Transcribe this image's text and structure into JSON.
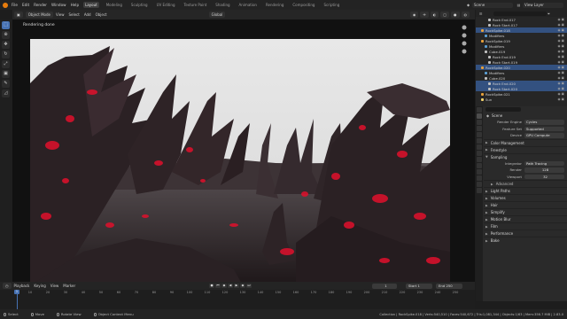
{
  "menu": {
    "items": [
      "File",
      "Edit",
      "Render",
      "Window",
      "Help"
    ],
    "workspaces": [
      "Layout",
      "Modeling",
      "Sculpting",
      "UV Editing",
      "Texture Paint",
      "Shading",
      "Animation",
      "Rendering",
      "Compositing",
      "Scripting"
    ],
    "active_workspace": "Layout",
    "scene_name": "Scene",
    "view_layer": "View Layer"
  },
  "viewport_header": {
    "mode": "Object Mode",
    "menus": [
      "View",
      "Select",
      "Add",
      "Object"
    ],
    "orientation": "Global"
  },
  "viewport": {
    "status": "Rendering done"
  },
  "outliner": {
    "rows": [
      {
        "label": "Rock End.017",
        "selected": false
      },
      {
        "label": "Rock Start.017",
        "selected": false
      },
      {
        "label": "RockSpike.018",
        "selected": true
      },
      {
        "label": "Modifiers",
        "selected": false
      },
      {
        "label": "RockSpike.019",
        "selected": false
      },
      {
        "label": "Modifiers",
        "selected": false
      },
      {
        "label": "Cube.019",
        "selected": false
      },
      {
        "label": "Rock End.019",
        "selected": false
      },
      {
        "label": "Rock Start.019",
        "selected": false
      },
      {
        "label": "RockSpike.020",
        "selected": true
      },
      {
        "label": "Modifiers",
        "selected": false
      },
      {
        "label": "Cube.020",
        "selected": false
      },
      {
        "label": "Rock End.020",
        "selected": true
      },
      {
        "label": "Rock Start.020",
        "selected": true
      },
      {
        "label": "RockSpike.021",
        "selected": false
      },
      {
        "label": "Sun",
        "selected": false
      }
    ]
  },
  "properties": {
    "scene_label": "Scene",
    "render_engine_label": "Render Engine",
    "render_engine": "Cycles",
    "feature_set_label": "Feature Set",
    "feature_set": "Supported",
    "device_label": "Device",
    "device": "GPU Compute",
    "sections_top": [
      "Color Management",
      "Freestyle",
      "Sampling"
    ],
    "integrator_label": "Integrator",
    "integrator": "Path Tracing",
    "render_samples_label": "Render",
    "render_samples": "128",
    "viewport_samples_label": "Viewport",
    "viewport_samples": "32",
    "sections_bottom": [
      {
        "label": "Advanced",
        "sub": true
      },
      {
        "label": "Light Paths",
        "sub": false
      },
      {
        "label": "Volumes",
        "sub": false
      },
      {
        "label": "Hair",
        "sub": false
      },
      {
        "label": "Simplify",
        "sub": false
      },
      {
        "label": "Motion Blur",
        "sub": false
      },
      {
        "label": "Film",
        "sub": false
      },
      {
        "label": "Performance",
        "sub": false
      },
      {
        "label": "Bake",
        "sub": false
      }
    ]
  },
  "timeline": {
    "menus": [
      "Playback",
      "Keying",
      "View",
      "Marker"
    ],
    "current_frame": "1",
    "start_label": "Start",
    "start": "1",
    "end_label": "End",
    "end": "250",
    "ruler": [
      "10",
      "20",
      "30",
      "40",
      "50",
      "60",
      "70",
      "80",
      "90",
      "100",
      "110",
      "120",
      "130",
      "140",
      "150",
      "160",
      "170",
      "180",
      "190",
      "200",
      "210",
      "220",
      "230",
      "240",
      "250"
    ],
    "playhead_label": "1"
  },
  "status": {
    "select": "Select",
    "move": "Move",
    "rotate": "Rotate View",
    "context": "Object Context Menu",
    "stats": "Collection | RockSpike.018 | Verts:540,510 | Faces:540,672 | Tris:1,081,344 | Objects:1/63 | Mem:356.7 MiB | 2.83.0"
  },
  "colors": {
    "accent": "#4772b3",
    "logo": "#e87d0d",
    "rock": "#2b2124",
    "glow": "#e0102c",
    "sky": "#e6e6e6"
  }
}
